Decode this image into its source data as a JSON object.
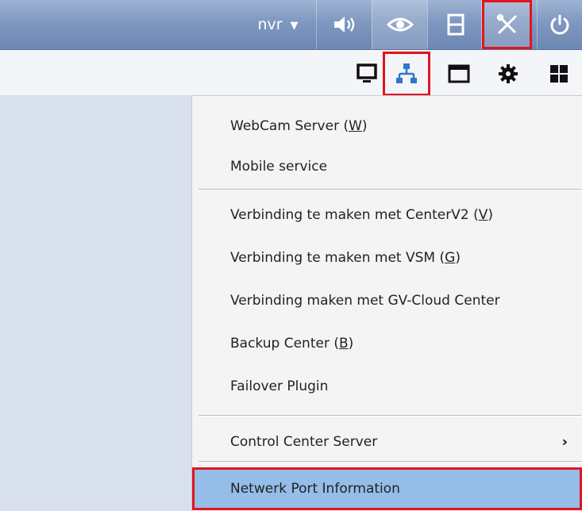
{
  "toolbar": {
    "user": "nvr",
    "buttons": [
      {
        "name": "volume-icon"
      },
      {
        "name": "eye-icon"
      },
      {
        "name": "film-icon"
      },
      {
        "name": "tools-icon",
        "highlighted": true
      },
      {
        "name": "power-icon"
      }
    ]
  },
  "subtoolbar": {
    "buttons": [
      {
        "name": "monitor-icon"
      },
      {
        "name": "network-icon",
        "highlighted": true
      },
      {
        "name": "window-icon"
      },
      {
        "name": "gear-icon"
      },
      {
        "name": "grid-icon"
      }
    ]
  },
  "menu": {
    "items": [
      {
        "label": "WebCam Server",
        "shortcut": "W"
      },
      {
        "label": "Mobile service",
        "shortcut": ""
      },
      {
        "label": "Verbinding te maken met CenterV2",
        "shortcut": "V"
      },
      {
        "label": "Verbinding te maken met VSM",
        "shortcut": "G"
      },
      {
        "label": "Verbinding maken met GV-Cloud Center",
        "shortcut": ""
      },
      {
        "label": "Backup Center",
        "shortcut": "B"
      },
      {
        "label": "Failover Plugin",
        "shortcut": ""
      },
      {
        "label": "Control Center Server",
        "shortcut": "",
        "submenu": true
      },
      {
        "label": "Netwerk Port Information",
        "shortcut": "",
        "selected": true
      }
    ],
    "selected_color": "#94bde8",
    "highlight_color": "#e3141f"
  }
}
